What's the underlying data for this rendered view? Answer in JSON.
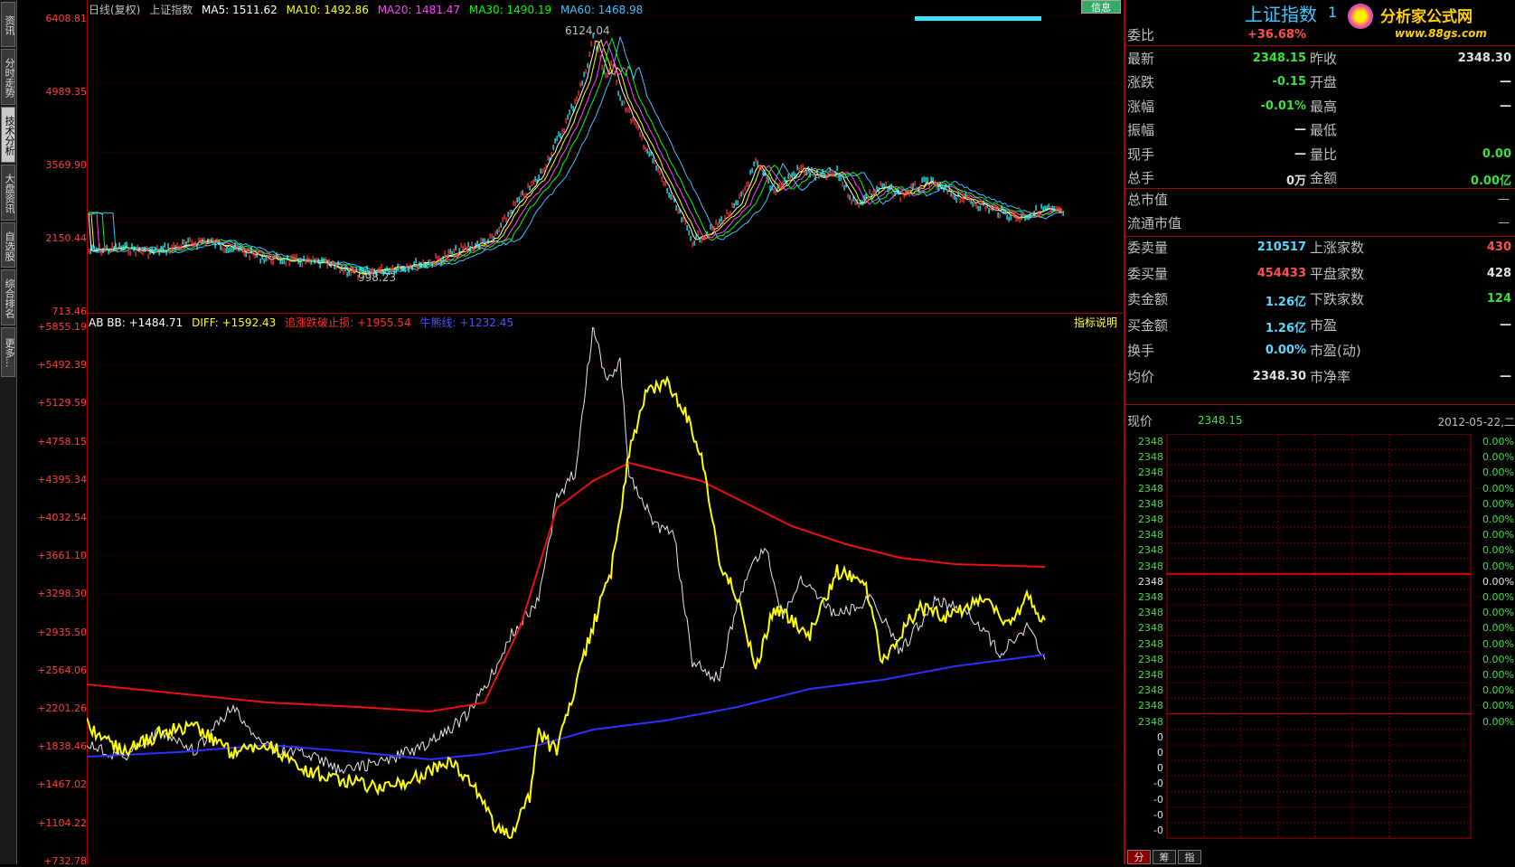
{
  "left_tabs": [
    "资讯",
    "分时走势",
    "技术分析",
    "大盘资讯",
    "自选股",
    "综合排名",
    "更多..."
  ],
  "main_chart": {
    "header": {
      "period": "日线(复权)",
      "index_name": "上证指数",
      "ma5": "MA5: 1511.62",
      "ma10": "MA10: 1492.86",
      "ma20": "MA20: 1481.47",
      "ma30": "MA30: 1490.19",
      "ma60": "MA60: 1468.98"
    },
    "y_ticks": [
      "6408.81",
      "4989.35",
      "3569.90",
      "2150.44",
      "713.46"
    ],
    "high_label": "6124.04",
    "low_label": "998.23",
    "button_info": "信息",
    "colors": {
      "ma5": "#ffffff",
      "ma10": "#ffff00",
      "ma20": "#ff40ff",
      "ma30": "#00ff00",
      "ma60": "#40c0ff"
    }
  },
  "indicator_chart": {
    "header": {
      "ab_bb": "AB BB: +1484.71",
      "diff": "DIFF: +1592.43",
      "stop": "追涨跌破止损: +1955.54",
      "bull": "牛熊线: +1232.45"
    },
    "explain_button": "指标说明",
    "y_ticks": [
      "+5855.19",
      "+5492.39",
      "+5129.59",
      "+4758.15",
      "+4395.34",
      "+4032.54",
      "+3661.10",
      "+3298.30",
      "+2935.50",
      "+2564.06",
      "+2201.26",
      "+1838.46",
      "+1467.02",
      "+1104.22",
      "+732.78"
    ],
    "colors": {
      "abbb": "#ffffff",
      "diff": "#ffff00",
      "stop": "#ff0000",
      "bull": "#4040ff"
    }
  },
  "info_panel": {
    "title": "上证指数",
    "title_code": "1",
    "logo_text": "分析家公式网",
    "logo_url": "www.88gs.com",
    "weibi_label": "委比",
    "weibi_value": "+36.68%",
    "rows_left": [
      {
        "label": "最新",
        "value": "2348.15"
      },
      {
        "label": "涨跌",
        "value": "-0.15"
      },
      {
        "label": "涨幅",
        "value": "-0.01%"
      },
      {
        "label": "振幅",
        "value": "—"
      },
      {
        "label": "现手",
        "value": "—"
      },
      {
        "label": "总手",
        "value": "0万"
      }
    ],
    "rows_right": [
      {
        "label": "昨收",
        "value": "2348.30"
      },
      {
        "label": "开盘",
        "value": "—"
      },
      {
        "label": "最高",
        "value": "—"
      },
      {
        "label": "最低",
        "value": ""
      },
      {
        "label": "量比",
        "value": "0.00"
      },
      {
        "label": "金额",
        "value": "0.00亿"
      }
    ],
    "cap_total_label": "总市值",
    "cap_total_value": "—",
    "cap_float_label": "流通市值",
    "cap_float_value": "—",
    "rows2_left": [
      {
        "label": "委卖量",
        "value": "210517"
      },
      {
        "label": "委买量",
        "value": "454433"
      },
      {
        "label": "卖金额",
        "value": "1.26亿"
      },
      {
        "label": "买金额",
        "value": "1.26亿"
      },
      {
        "label": "换手",
        "value": "0.00%"
      },
      {
        "label": "均价",
        "value": "2348.30"
      }
    ],
    "rows2_right": [
      {
        "label": "上涨家数",
        "value": "430"
      },
      {
        "label": "平盘家数",
        "value": "428"
      },
      {
        "label": "下跌家数",
        "value": "124"
      },
      {
        "label": "市盈",
        "value": "—"
      },
      {
        "label": "市盈(动)",
        "value": ""
      },
      {
        "label": "市净率",
        "value": "—"
      }
    ],
    "price_label": "现价",
    "price_value": "2348.15",
    "date": "2012-05-22,二",
    "depth_prices": [
      "2348",
      "2348",
      "2348",
      "2348",
      "2348",
      "2348",
      "2348",
      "2348",
      "2348",
      "2348",
      "2348",
      "2348",
      "2348",
      "2348",
      "2348",
      "2348",
      "2348",
      "2348",
      "2348"
    ],
    "depth_volumes": [
      "0",
      "0",
      "0",
      "-0",
      "-0",
      "-0",
      "-0"
    ],
    "depth_pcts": [
      "0.00%",
      "0.00%",
      "0.00%",
      "0.00%",
      "0.00%",
      "0.00%",
      "0.00%",
      "0.00%",
      "0.00%",
      "0.00%",
      "0.00%",
      "0.00%",
      "0.00%",
      "0.00%",
      "0.00%",
      "0.00%",
      "0.00%",
      "0.00%",
      "0.00%"
    ],
    "bottom_tabs": [
      "分",
      "筹",
      "指"
    ]
  }
}
